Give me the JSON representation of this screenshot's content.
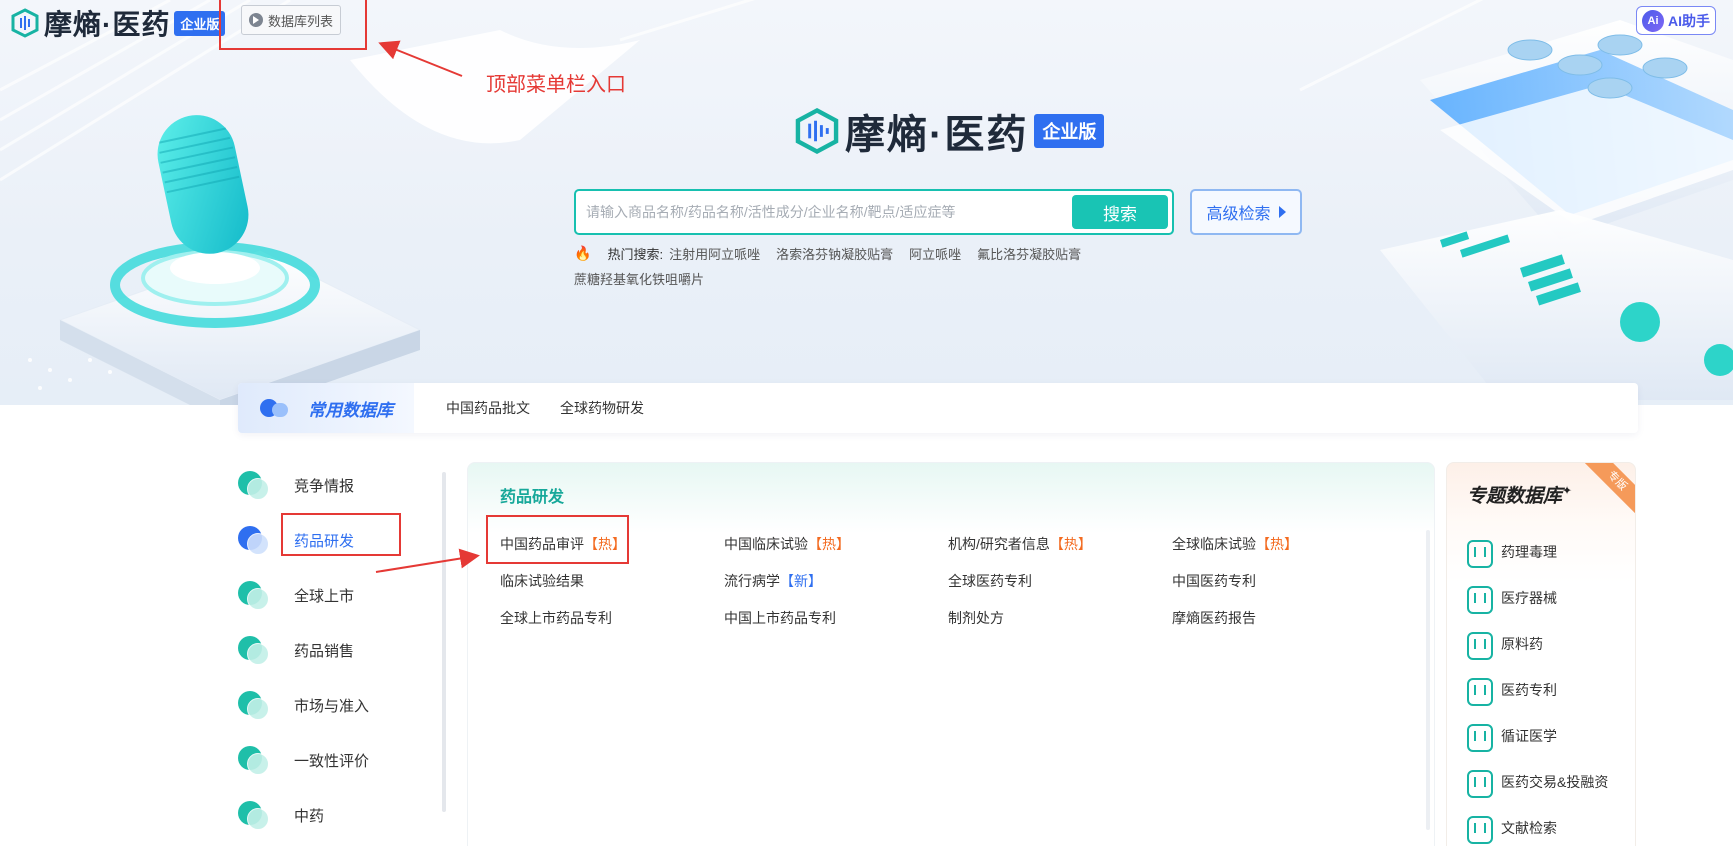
{
  "brand": {
    "name": "摩熵·医药",
    "edition_badge": "企业版"
  },
  "topbar": {
    "db_list_label": "数据库列表",
    "ai_assistant_label": "AI助手",
    "ai_icon_text": "Ai"
  },
  "annotation": {
    "top_menu_entry": "顶部菜单栏入口"
  },
  "search": {
    "placeholder": "请输入商品名称/药品名称/活性成分/企业名称/靶点/适应症等",
    "value": "",
    "search_button": "搜索",
    "advanced_button": "高级检索"
  },
  "hot_search": {
    "label": "热门搜索:",
    "items": [
      "注射用阿立哌唑",
      "洛索洛芬钠凝胶贴膏",
      "阿立哌唑",
      "氟比洛芬凝胶贴膏",
      "蔗糖羟基氧化铁咀嚼片"
    ]
  },
  "common_db": {
    "title": "常用数据库",
    "links": [
      "中国药品批文",
      "全球药物研发"
    ]
  },
  "left_nav": {
    "items": [
      {
        "label": "竞争情报",
        "active": false
      },
      {
        "label": "药品研发",
        "active": true
      },
      {
        "label": "全球上市",
        "active": false
      },
      {
        "label": "药品销售",
        "active": false
      },
      {
        "label": "市场与准入",
        "active": false
      },
      {
        "label": "一致性评价",
        "active": false
      },
      {
        "label": "中药",
        "active": false
      }
    ]
  },
  "section": {
    "title": "药品研发",
    "items": [
      {
        "label": "中国药品审评",
        "tag": "【热】",
        "tag_type": "hot"
      },
      {
        "label": "中国临床试验",
        "tag": "【热】",
        "tag_type": "hot"
      },
      {
        "label": "机构/研究者信息",
        "tag": "【热】",
        "tag_type": "hot"
      },
      {
        "label": "全球临床试验",
        "tag": "【热】",
        "tag_type": "hot"
      },
      {
        "label": "临床试验结果",
        "tag": "",
        "tag_type": ""
      },
      {
        "label": "流行病学",
        "tag": "【新】",
        "tag_type": "new"
      },
      {
        "label": "全球医药专利",
        "tag": "",
        "tag_type": ""
      },
      {
        "label": "中国医药专利",
        "tag": "",
        "tag_type": ""
      },
      {
        "label": "全球上市药品专利",
        "tag": "",
        "tag_type": ""
      },
      {
        "label": "中国上市药品专利",
        "tag": "",
        "tag_type": ""
      },
      {
        "label": "制剂处方",
        "tag": "",
        "tag_type": ""
      },
      {
        "label": "摩熵医药报告",
        "tag": "",
        "tag_type": ""
      }
    ]
  },
  "special_db": {
    "title": "专题数据库",
    "ribbon": "专版",
    "items": [
      "药理毒理",
      "医疗器械",
      "原料药",
      "医药专利",
      "循证医学",
      "医药交易&投融资",
      "文献检索"
    ]
  },
  "colors": {
    "accent_blue": "#2f6ff0",
    "accent_teal": "#19c4b4",
    "hot_orange": "#f36b21",
    "annotation_red": "#e53935"
  }
}
